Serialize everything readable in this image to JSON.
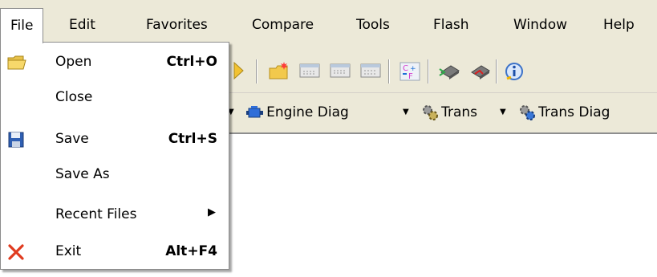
{
  "menubar": {
    "items": [
      "File",
      "Edit",
      "Favorites",
      "Compare",
      "Tools",
      "Flash",
      "Window",
      "Help"
    ]
  },
  "toolbar2": {
    "buttons": [
      "Engine Diag",
      "Trans",
      "Trans Diag"
    ]
  },
  "file_menu": {
    "items": [
      {
        "label": "Open",
        "shortcut": "Ctrl+O",
        "icon": "folder-open-icon"
      },
      {
        "label": "Close",
        "shortcut": "",
        "icon": ""
      },
      {
        "label": "Save",
        "shortcut": "Ctrl+S",
        "icon": "floppy-disk-icon"
      },
      {
        "label": "Save As",
        "shortcut": "",
        "icon": ""
      },
      {
        "label": "Recent Files",
        "shortcut": "",
        "icon": ""
      },
      {
        "label": "Exit",
        "shortcut": "Alt+F4",
        "icon": "red-x-icon"
      }
    ]
  },
  "colors": {
    "chrome": "#ece9d8",
    "menu_bg": "#ffffff",
    "exit_x": "#e03b1f"
  }
}
